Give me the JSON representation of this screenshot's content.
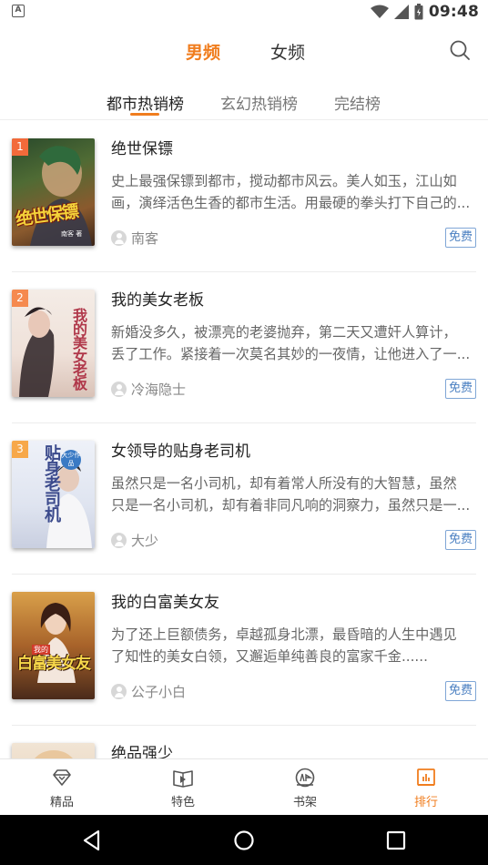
{
  "status_bar": {
    "time": "09:48",
    "left_icon_letter": "A"
  },
  "header": {
    "tabs": [
      {
        "label": "男频",
        "active": true
      },
      {
        "label": "女频",
        "active": false
      }
    ],
    "search_icon": "search-icon"
  },
  "subtabs": [
    {
      "label": "都市热销榜",
      "active": true
    },
    {
      "label": "玄幻热销榜",
      "active": false
    },
    {
      "label": "完结榜",
      "active": false
    }
  ],
  "books": [
    {
      "rank": "1",
      "rank_color": "#f26a3a",
      "title": "绝世保镖",
      "desc_line1": "史上最强保镖到都市，搅动都市风云。美人如玉，江山如",
      "desc_line2": "画，演绎活色生香的都市生活。用最硬的拳头打下自己的...",
      "author": "南客",
      "badge": "免费",
      "cover_text": "绝世保镖",
      "cover_sub": "南客 著"
    },
    {
      "rank": "2",
      "rank_color": "#f58a4f",
      "title": "我的美女老板",
      "desc_line1": "新婚没多久，被漂亮的老婆抛弃，第二天又遭奸人算计，",
      "desc_line2": "丢了工作。紧接着一次莫名其妙的一夜情，让他进入了一...",
      "author": "冷海隐士",
      "badge": "免费",
      "cover_text": "我的美女老板",
      "cover_sub": ""
    },
    {
      "rank": "3",
      "rank_color": "#f7a84a",
      "title": "女领导的贴身老司机",
      "desc_line1": "虽然只是一名小司机，却有着常人所没有的大智慧，虽然",
      "desc_line2": "只是一名小司机，却有着非同凡响的洞察力，虽然只是一...",
      "author": "大少",
      "badge": "免费",
      "cover_text": "贴身老司机",
      "cover_sub": "大少作品"
    },
    {
      "rank": "",
      "rank_color": "",
      "title": "我的白富美女友",
      "desc_line1": "为了还上巨额债务，卓越孤身北漂，最昏暗的人生中遇见",
      "desc_line2": "了知性的美女白领，又邂逅单纯善良的富家千金......",
      "author": "公子小白",
      "badge": "免费",
      "cover_text": "白富美女友",
      "cover_sub": "我的"
    },
    {
      "rank": "",
      "rank_color": "",
      "title": "绝品强少",
      "desc_line1": "",
      "desc_line2": "",
      "author": "",
      "badge": "",
      "cover_text": "",
      "cover_sub": ""
    }
  ],
  "bottom_nav": [
    {
      "label": "精品",
      "icon": "diamond-icon",
      "active": false
    },
    {
      "label": "特色",
      "icon": "book-open-icon",
      "active": false
    },
    {
      "label": "书架",
      "icon": "shelf-icon",
      "active": false
    },
    {
      "label": "排行",
      "icon": "ranking-icon",
      "active": true
    }
  ],
  "colors": {
    "accent": "#f07d1e",
    "badge_blue": "#4a7fc1"
  }
}
